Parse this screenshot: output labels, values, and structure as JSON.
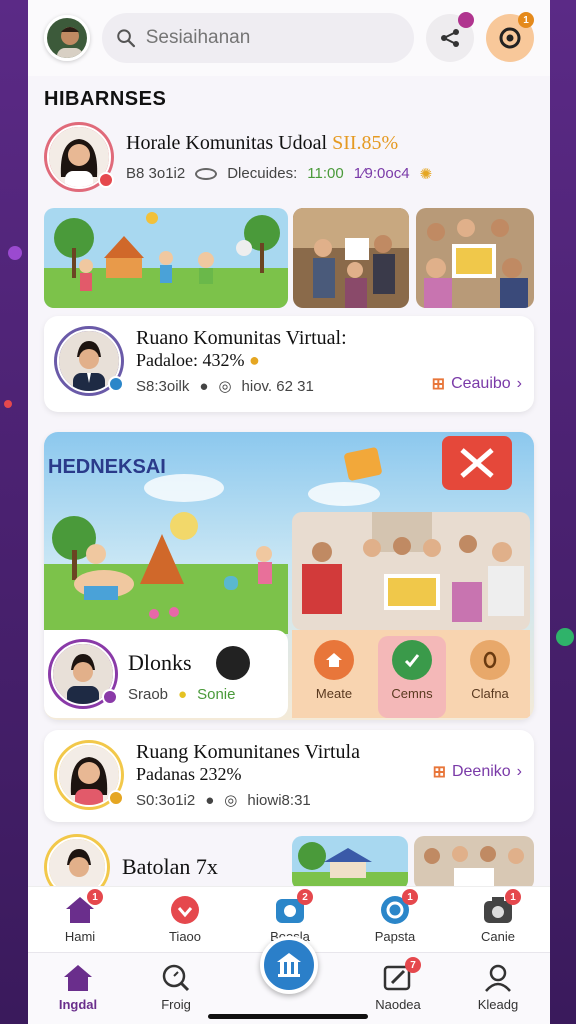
{
  "header": {
    "search_placeholder": "Sesiaihanan",
    "notif_badge": "",
    "alert_badge": "1"
  },
  "section_title": "HIBARNSES",
  "posts": [
    {
      "title": "Horale Komunitas Udoal",
      "title_accent": "SII.85%",
      "meta_left": "B8 3o1i2",
      "meta_mid": "Dlecuides:",
      "meta_time": "11:00",
      "meta_right": "1⁄9:0oc4"
    },
    {
      "title": "Ruano Komunitas Virtual:",
      "subtitle": "Padaloe: 432%",
      "meta_left": "S8:3oilk",
      "meta_right": "hiov. 62 31",
      "action": "Ceauibo"
    },
    {
      "title": "Ruang Komunitanes Virtula",
      "subtitle": "Padanas 232%",
      "meta_left": "S0:3o1i2",
      "meta_right": "hiowi8:31",
      "action": "Deeniko"
    },
    {
      "title": "Batolan 7x"
    }
  ],
  "banner": {
    "title": "HEDNEKSAI",
    "name": "Dlonks",
    "meta_left": "Sraob",
    "meta_right": "Sonie",
    "tiles": [
      {
        "label": "Meate",
        "color": "#e8763a"
      },
      {
        "label": "Cemns",
        "color": "#3a9a4a"
      },
      {
        "label": "Clafna",
        "color": "#b86a2a"
      }
    ]
  },
  "nav_top": [
    {
      "label": "Hami",
      "icon": "home-icon",
      "badge": "1",
      "color": "#6a2e8c"
    },
    {
      "label": "Tiaoo",
      "icon": "heart-icon",
      "badge": "",
      "color": "#e5484d"
    },
    {
      "label": "Boosla",
      "icon": "camera-icon",
      "badge": "2",
      "color": "#2b86c9"
    },
    {
      "label": "Papsta",
      "icon": "refresh-icon",
      "badge": "1",
      "color": "#2b86c9"
    },
    {
      "label": "Canie",
      "icon": "camera-icon",
      "badge": "1",
      "color": "#444"
    }
  ],
  "nav_bottom": [
    {
      "label": "Ingdal",
      "icon": "home-icon",
      "active": true
    },
    {
      "label": "Froig",
      "icon": "search-icon",
      "active": false
    },
    {
      "label": "Naodea",
      "icon": "edit-icon",
      "badge": "7",
      "active": false
    },
    {
      "label": "Kleadg",
      "icon": "user-icon",
      "active": false
    }
  ],
  "colors": {
    "brand_purple": "#6a2e8c",
    "accent_orange": "#e59a22",
    "accent_blue": "#2b7fc9"
  }
}
